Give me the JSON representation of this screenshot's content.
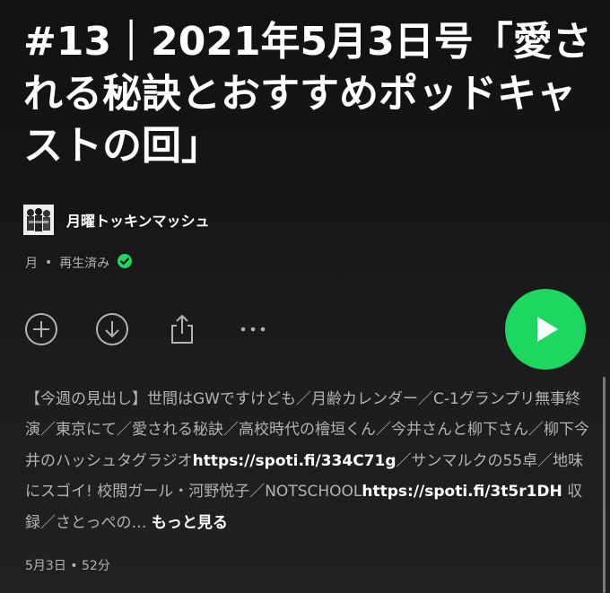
{
  "episode": {
    "title": "#13｜2021年5月3日号「愛される秘訣とおすすめポッドキャストの回」"
  },
  "show": {
    "name": "月曜トッキンマッシュ",
    "art_icon": "show-artwork"
  },
  "meta": {
    "day": "月",
    "separator": "•",
    "status": "再生済み",
    "status_icon": "check-circle-icon",
    "status_color": "#1ed760"
  },
  "actions": {
    "add_icon": "plus-circle-icon",
    "download_icon": "download-circle-icon",
    "share_icon": "share-icon",
    "more_icon": "more-dots-icon",
    "play_icon": "play-icon",
    "play_color": "#1ed760"
  },
  "description": {
    "text1": "【今週の見出し】世間はGWですけども／月齢カレンダー／C-1グランプリ無事終演／東京にて／愛される秘訣／高校時代の檜垣くん／今井さんと柳下さん／柳下今井のハッシュタグラジオ",
    "link1": "https://spoti.fi/334C71g",
    "text2": "／サンマルクの55卓／地味にスゴイ! 校閲ガール・河野悦子／NOTSCHOOL",
    "link2": "https://spoti.fi/3t5r1DH",
    "text3": " 収録／さとっぺの… ",
    "more_label": "もっと見る"
  },
  "footer": {
    "date": "5月3日",
    "separator": "•",
    "duration": "52分"
  }
}
